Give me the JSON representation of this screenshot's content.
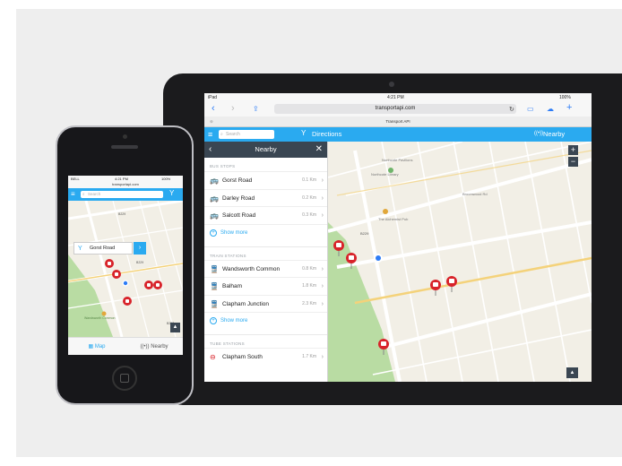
{
  "colors": {
    "accent": "#2aaaf0",
    "header": "#3a4652",
    "stop": "#d8232a",
    "park": "#b5d9a0"
  },
  "ipad": {
    "status": {
      "left": "iPad",
      "time": "4:21 PM",
      "battery": "100%"
    },
    "url": "transportapi.com",
    "tab_title": "Transport API",
    "app": {
      "search_placeholder": "Search",
      "directions_label": "Directions",
      "nearby_label": "Nearby"
    },
    "panel": {
      "title": "Nearby",
      "sections": {
        "bus": {
          "heading": "BUS STOPS",
          "rows": [
            {
              "name": "Gorst Road",
              "distance": "0.1 Km"
            },
            {
              "name": "Darley Road",
              "distance": "0.2 Km"
            },
            {
              "name": "Salcott Road",
              "distance": "0.3 Km"
            }
          ],
          "more": "Show more"
        },
        "train": {
          "heading": "TRAIN STATIONS",
          "rows": [
            {
              "name": "Wandsworth Common",
              "distance": "0.8 Km"
            },
            {
              "name": "Balham",
              "distance": "1.8 Km"
            },
            {
              "name": "Clapham Junction",
              "distance": "2.3 Km"
            }
          ],
          "more": "Show more"
        },
        "tube": {
          "heading": "TUBE STATIONS",
          "rows": [
            {
              "name": "Clapham South",
              "distance": "1.7 Km"
            }
          ]
        }
      }
    },
    "map": {
      "places": {
        "northcote": "Northcote Pavilions",
        "library": "Northcote Library",
        "dudes": "The Alchemist Pub",
        "road1": "Broomwood Rd",
        "road2": "B229"
      }
    }
  },
  "iphone": {
    "status": {
      "carrier": "BELL",
      "time": "4:21 PM",
      "battery": "100%"
    },
    "url": "transportapi.com",
    "search_placeholder": "Search",
    "callout": "Gorst Road",
    "map": {
      "road1": "B229",
      "road2": "B229",
      "park": "Wandsworth Common",
      "road3": "B237"
    },
    "tabs": {
      "map": "Map",
      "nearby": "Nearby"
    }
  }
}
